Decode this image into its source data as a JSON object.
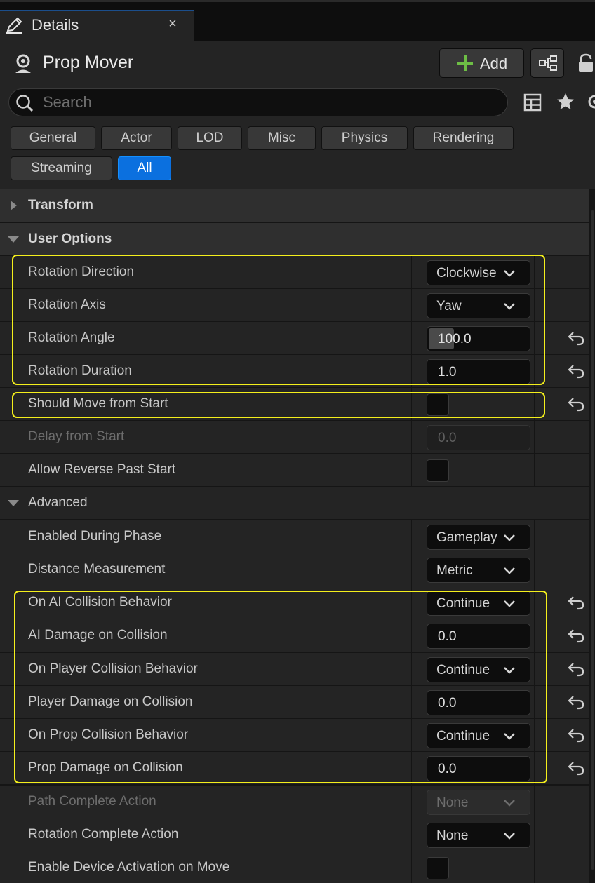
{
  "tab": {
    "title": "Details",
    "close": "×"
  },
  "header": {
    "actor_name": "Prop Mover",
    "add_label": "Add",
    "search_placeholder": "Search"
  },
  "filters": [
    {
      "label": "General",
      "active": false
    },
    {
      "label": "Actor",
      "active": false
    },
    {
      "label": "LOD",
      "active": false
    },
    {
      "label": "Misc",
      "active": false
    },
    {
      "label": "Physics",
      "active": false
    },
    {
      "label": "Rendering",
      "active": false
    },
    {
      "label": "Streaming",
      "active": false
    },
    {
      "label": "All",
      "active": true
    }
  ],
  "sections": {
    "transform": "Transform",
    "user_options": "User Options",
    "advanced": "Advanced"
  },
  "properties": {
    "rotation_direction": {
      "label": "Rotation Direction",
      "value": "Clockwise"
    },
    "rotation_axis": {
      "label": "Rotation Axis",
      "value": "Yaw"
    },
    "rotation_angle": {
      "label": "Rotation Angle",
      "value": "100.0"
    },
    "rotation_duration": {
      "label": "Rotation Duration",
      "value": "1.0"
    },
    "should_move_from_start": {
      "label": "Should Move from Start",
      "checked": false
    },
    "delay_from_start": {
      "label": "Delay from Start",
      "value": "0.0"
    },
    "allow_reverse_past_start": {
      "label": "Allow Reverse Past Start",
      "checked": false
    },
    "enabled_during_phase": {
      "label": "Enabled During Phase",
      "value": "Gameplay"
    },
    "distance_measurement": {
      "label": "Distance Measurement",
      "value": "Metric"
    },
    "on_ai_collision_behavior": {
      "label": "On AI Collision Behavior",
      "value": "Continue"
    },
    "ai_damage_on_collision": {
      "label": "AI Damage on Collision",
      "value": "0.0"
    },
    "on_player_collision_behavior": {
      "label": "On Player Collision Behavior",
      "value": "Continue"
    },
    "player_damage_on_collision": {
      "label": "Player Damage on Collision",
      "value": "0.0"
    },
    "on_prop_collision_behavior": {
      "label": "On Prop Collision Behavior",
      "value": "Continue"
    },
    "prop_damage_on_collision": {
      "label": "Prop Damage on Collision",
      "value": "0.0"
    },
    "path_complete_action": {
      "label": "Path Complete Action",
      "value": "None"
    },
    "rotation_complete_action": {
      "label": "Rotation Complete Action",
      "value": "None"
    },
    "enable_device_activation_on_move": {
      "label": "Enable Device Activation on Move",
      "checked": false
    }
  },
  "colors": {
    "highlight": "#f4ef1c",
    "active_filter": "#0b70df",
    "add_plus": "#6dbe45"
  }
}
